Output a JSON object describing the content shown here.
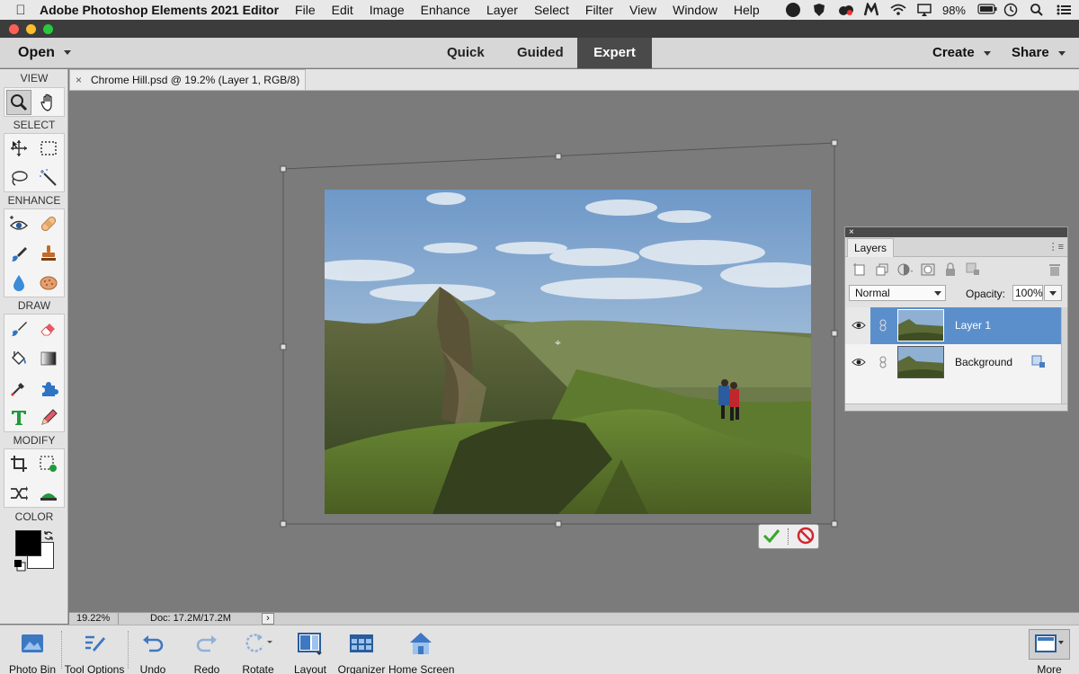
{
  "menubar": {
    "app_name": "Adobe Photoshop Elements 2021 Editor",
    "items": [
      "File",
      "Edit",
      "Image",
      "Enhance",
      "Layer",
      "Select",
      "Filter",
      "View",
      "Window",
      "Help"
    ],
    "battery": "98%"
  },
  "header": {
    "open_label": "Open",
    "modes": [
      "Quick",
      "Guided",
      "Expert"
    ],
    "active_mode": "Expert",
    "create_label": "Create",
    "share_label": "Share"
  },
  "toolbar": {
    "sections": [
      "VIEW",
      "SELECT",
      "ENHANCE",
      "DRAW",
      "MODIFY",
      "COLOR"
    ]
  },
  "document": {
    "tab_close": "×",
    "tab_title": "Chrome Hill.psd @ 19.2% (Layer 1, RGB/8) *"
  },
  "status": {
    "zoom": "19.22%",
    "doc_size": "Doc: 17.2M/17.2M"
  },
  "layers_panel": {
    "close": "×",
    "tab": "Layers",
    "blend_mode": "Normal",
    "opacity_label": "Opacity:",
    "opacity_value": "100%",
    "layers": [
      {
        "name": "Layer 1",
        "selected": true
      },
      {
        "name": "Background",
        "selected": false
      }
    ]
  },
  "bottom_bar": {
    "photo_bin": "Photo Bin",
    "tool_options": "Tool Options",
    "undo": "Undo",
    "redo": "Redo",
    "rotate": "Rotate",
    "layout": "Layout",
    "organizer": "Organizer",
    "home_screen": "Home Screen",
    "more": "More"
  },
  "colors": {
    "accent_selected_layer": "#5b8fcc",
    "expert_tab": "#4a4a4a",
    "foreground": "#000000",
    "background": "#ffffff"
  }
}
